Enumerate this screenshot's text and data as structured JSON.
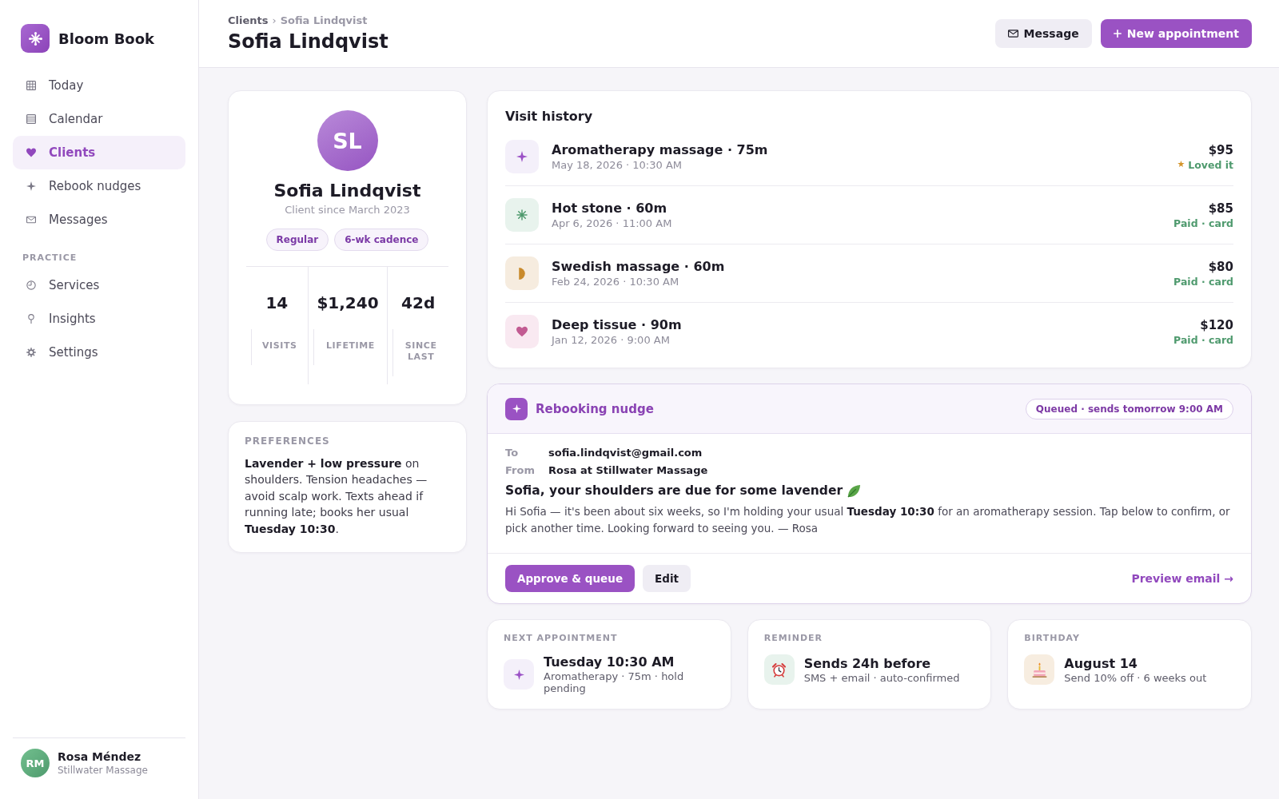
{
  "sidebar": {
    "brand": "Bloom Book",
    "sections": [
      {
        "items": [
          {
            "label": "Today",
            "kind": "grid",
            "selected": false
          },
          {
            "label": "Calendar",
            "kind": "lines",
            "selected": false
          },
          {
            "label": "Clients",
            "kind": "heart",
            "selected": true
          },
          {
            "label": "Rebook nudges",
            "kind": "sparkle",
            "selected": false
          },
          {
            "label": "Messages",
            "kind": "envelope",
            "selected": false
          }
        ]
      },
      {
        "heading": "PRACTICE",
        "items": [
          {
            "label": "Services",
            "kind": "clock",
            "selected": false
          },
          {
            "label": "Insights",
            "kind": "pin",
            "selected": false
          },
          {
            "label": "Settings",
            "kind": "gear",
            "selected": false
          }
        ]
      }
    ],
    "user": {
      "initials": "RM",
      "name": "Rosa Méndez",
      "business": "Stillwater Massage"
    }
  },
  "header": {
    "breadcrumb": {
      "items": [
        "Clients",
        "Sofia Lindqvist"
      ],
      "separator": "›"
    },
    "title": "Sofia Lindqvist",
    "buttons": [
      {
        "label": "Message",
        "kind": "envelope",
        "primary": false
      },
      {
        "label": "New appointment",
        "kind": "plus",
        "primary": true
      }
    ]
  },
  "profile": {
    "initials": "SL",
    "name": "Sofia Lindqvist",
    "since": "Client since March 2023",
    "tags": [
      "Regular",
      "6-wk cadence"
    ],
    "stats": [
      {
        "value": "14",
        "label": "VISITS"
      },
      {
        "value": "$1,240",
        "label": "LIFETIME"
      },
      {
        "value": "42d",
        "label": "SINCE LAST"
      }
    ]
  },
  "preferences": {
    "heading": "PREFERENCES",
    "text": "**Lavender + low pressure** on shoulders. Tension headaches — avoid scalp work. Texts ahead if running late; books her usual **Tuesday 10:30**."
  },
  "visit_history": {
    "title": "Visit history",
    "visits": [
      {
        "kind": "sparkle",
        "service": "Aromatherapy massage · 75m",
        "date": "May 18, 2026 · 10:30 AM",
        "price": "$95",
        "status_icon": "★",
        "status": "Loved it"
      },
      {
        "kind": "asterisk",
        "service": "Hot stone · 60m",
        "date": "Apr 6, 2026 · 11:00 AM",
        "price": "$85",
        "status": "Paid · card"
      },
      {
        "kind": "moon",
        "service": "Swedish massage · 60m",
        "date": "Feb 24, 2026 · 10:30 AM",
        "price": "$80",
        "status": "Paid · card"
      },
      {
        "kind": "heart",
        "service": "Deep tissue · 90m",
        "date": "Jan 12, 2026 · 9:00 AM",
        "price": "$120",
        "status": "Paid · card"
      }
    ]
  },
  "rebooking_nudge": {
    "title": "Rebooking nudge",
    "status": "Queued · sends tomorrow 9:00 AM",
    "fields": [
      {
        "label": "To",
        "value": "sofia.lindqvist@gmail.com"
      },
      {
        "label": "From",
        "value": "Rosa at Stillwater Massage"
      }
    ],
    "subject": "Sofia, your shoulders are due for some lavender",
    "body": "Hi Sofia — it's been about six weeks, so I'm holding your usual **Tuesday 10:30** for an aromatherapy session. Tap below to confirm, or pick another time. Looking forward to seeing you. — Rosa",
    "buttons": [
      {
        "label": "Approve & queue",
        "primary": true
      },
      {
        "label": "Edit",
        "primary": false
      }
    ],
    "link": "Preview email →"
  },
  "summary_cards": [
    {
      "label": "NEXT APPOINTMENT",
      "kind": "sparkle",
      "title": "Tuesday 10:30 AM",
      "detail": "Aromatherapy · 75m · hold pending"
    },
    {
      "label": "REMINDER",
      "kind": "alarm",
      "title": "Sends 24h before",
      "detail": "SMS + email · auto-confirmed"
    },
    {
      "label": "BIRTHDAY",
      "kind": "cake",
      "title": "August 14",
      "detail": "Send 10% off · 6 weeks out"
    }
  ]
}
